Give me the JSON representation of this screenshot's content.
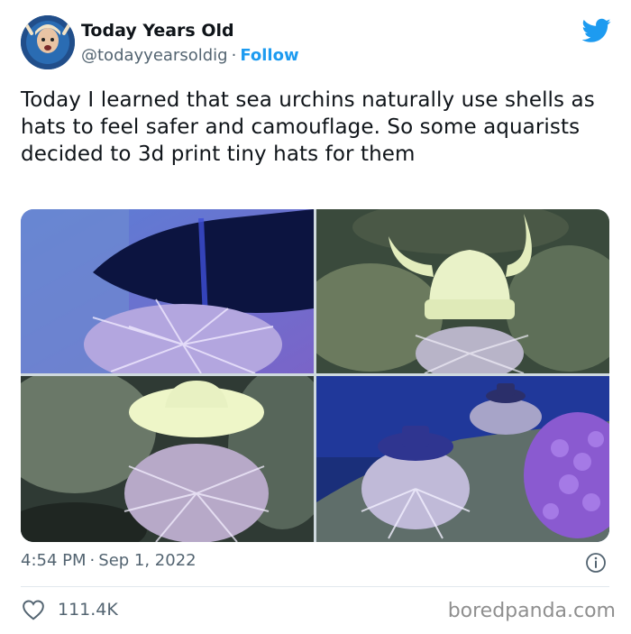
{
  "author": {
    "name": "Today Years Old",
    "handle": "@todayyearsoldig",
    "separator": "·",
    "follow_label": "Follow"
  },
  "tweet": {
    "text": "Today I learned that sea urchins naturally use shells as hats to feel safer and camouflage. So some aquarists decided to 3d print tiny hats for them"
  },
  "media": {
    "photos": [
      {
        "subject": "sea urchin with dark cone hat"
      },
      {
        "subject": "sea urchin with viking helmet hat"
      },
      {
        "subject": "sea urchin with cowboy hat"
      },
      {
        "subject": "sea urchins with small top hats"
      }
    ]
  },
  "meta": {
    "time": "4:54 PM",
    "separator": "·",
    "date": "Sep 1, 2022"
  },
  "engagement": {
    "likes": "111.4K"
  },
  "watermark": "boredpanda.com",
  "colors": {
    "accent": "#1d9bf0",
    "text": "#0f1419",
    "muted": "#536471",
    "divider": "#e1e8ed"
  },
  "icons": [
    "avatar",
    "twitter-bird-icon",
    "info-icon",
    "heart-icon"
  ]
}
